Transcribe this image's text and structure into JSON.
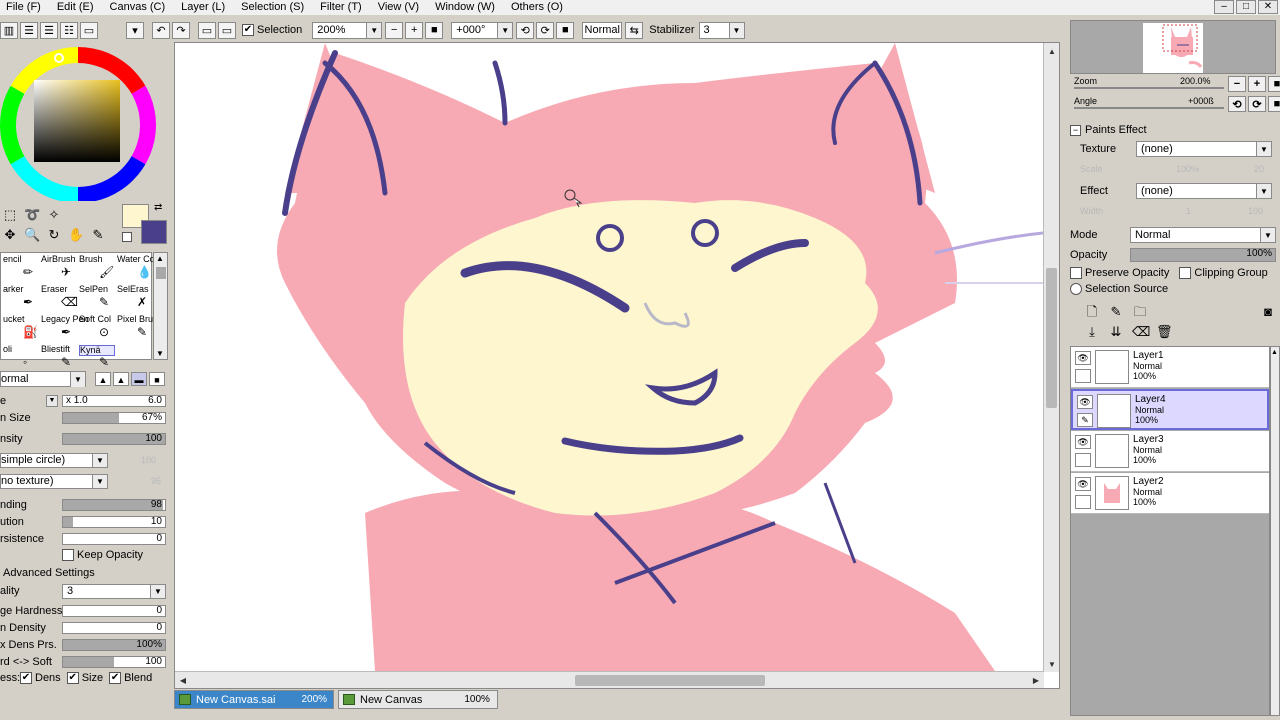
{
  "menu": [
    "File (F)",
    "Edit (E)",
    "Canvas (C)",
    "Layer (L)",
    "Selection (S)",
    "Filter (T)",
    "View (V)",
    "Window (W)",
    "Others (O)"
  ],
  "toolbar": {
    "selection_label": "Selection",
    "zoom_value": "200%",
    "angle_value": "+000°",
    "blend_value": "Normal",
    "stabilizer_label": "Stabilizer",
    "stabilizer_value": "3"
  },
  "tools": {
    "brushes": [
      {
        "label": "encil",
        "col": 0,
        "row": 0
      },
      {
        "label": "AirBrush",
        "col": 1,
        "row": 0
      },
      {
        "label": "Brush",
        "col": 2,
        "row": 0
      },
      {
        "label": "Water Color",
        "col": 3,
        "row": 0
      },
      {
        "label": "arker",
        "col": 0,
        "row": 1
      },
      {
        "label": "Eraser",
        "col": 1,
        "row": 1
      },
      {
        "label": "SelPen",
        "col": 2,
        "row": 1
      },
      {
        "label": "SelEras",
        "col": 3,
        "row": 1
      },
      {
        "label": "ucket",
        "col": 0,
        "row": 2
      },
      {
        "label": "Legacy Pen",
        "col": 1,
        "row": 2
      },
      {
        "label": "Soft Col",
        "col": 2,
        "row": 2
      },
      {
        "label": "Pixel Bru",
        "col": 3,
        "row": 2
      },
      {
        "label": "oli",
        "col": 0,
        "row": 3
      },
      {
        "label": "Bliestift",
        "col": 1,
        "row": 3
      },
      {
        "label": "Kynä",
        "col": 2,
        "row": 3
      }
    ],
    "blend_mode": "ormal",
    "brush_size_mult": "x 1.0",
    "brush_size_value": "6.0",
    "min_size_label": "n Size",
    "min_size_value": "67%",
    "density_label": "nsity",
    "density_value": "100",
    "shape_value": "simple circle)",
    "shape_amount": "100",
    "texture_value": "no texture)",
    "texture_amount": "95",
    "blending_label": "nding",
    "blending_value": "98",
    "dilution_label": "ution",
    "dilution_value": "10",
    "persistence_label": "rsistence",
    "persistence_value": "0",
    "keep_opacity_label": "Keep Opacity",
    "advanced_label": "Advanced Settings",
    "quality_label": "ality",
    "quality_value": "3",
    "edge_hardness_label": "ge Hardness",
    "edge_hardness_value": "0",
    "min_density_label": "n Density",
    "min_density_value": "0",
    "max_dens_label": "x Dens Prs.",
    "max_dens_value": "100%",
    "hard_soft_label": "rd <-> Soft",
    "hard_soft_value": "100",
    "press_label": "ess:",
    "dens_label": "Dens",
    "size_label": "Size",
    "blend_label": "Blend",
    "colors": {
      "main": "#fdf6cf",
      "secondary": "#4a3f8a"
    }
  },
  "navigator": {
    "zoom_label": "Zoom",
    "zoom_value": "200.0%",
    "angle_label": "Angle",
    "angle_value": "+000ß"
  },
  "paint_effect": {
    "section_label": "Paints Effect",
    "texture_label": "Texture",
    "texture_value": "(none)",
    "scale_label": "Scale",
    "scale_value": "100%",
    "scale_amount": "20",
    "effect_label": "Effect",
    "effect_value": "(none)",
    "width_label": "Width",
    "width_value": "1",
    "width_amount": "100"
  },
  "layer_props": {
    "mode_label": "Mode",
    "mode_value": "Normal",
    "opacity_label": "Opacity",
    "opacity_value": "100%",
    "preserve_opacity_label": "Preserve Opacity",
    "clipping_group_label": "Clipping Group",
    "selection_source_label": "Selection Source"
  },
  "layers": [
    {
      "name": "Layer1",
      "mode": "Normal",
      "opacity": "100%",
      "selected": false
    },
    {
      "name": "Layer4",
      "mode": "Normal",
      "opacity": "100%",
      "selected": true
    },
    {
      "name": "Layer3",
      "mode": "Normal",
      "opacity": "100%",
      "selected": false
    },
    {
      "name": "Layer2",
      "mode": "Normal",
      "opacity": "100%",
      "selected": false
    }
  ],
  "doc_tabs": [
    {
      "name": "New Canvas.sai",
      "zoom": "200%",
      "active": true
    },
    {
      "name": "New Canvas",
      "zoom": "100%",
      "active": false
    }
  ],
  "canvas_colors": {
    "fur": "#f7aab4",
    "face": "#fdf6cf",
    "line": "#4a3f8a"
  }
}
